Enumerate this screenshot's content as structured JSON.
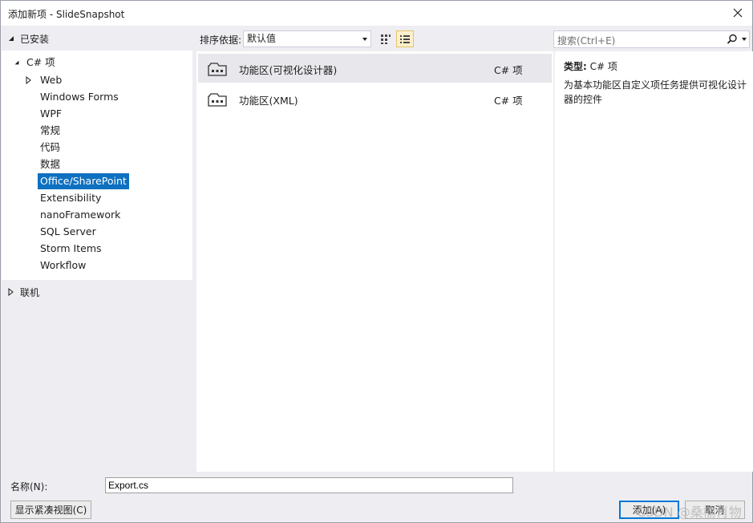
{
  "window": {
    "title": "添加新项 - SlideSnapshot"
  },
  "installed": {
    "label": "已安装"
  },
  "online": {
    "label": "联机"
  },
  "tree": {
    "root": "C# 项",
    "items": [
      {
        "label": "Web",
        "expandable": true
      },
      {
        "label": "Windows Forms"
      },
      {
        "label": "WPF"
      },
      {
        "label": "常规"
      },
      {
        "label": "代码"
      },
      {
        "label": "数据"
      },
      {
        "label": "Office/SharePoint",
        "selected": true
      },
      {
        "label": "Extensibility"
      },
      {
        "label": "nanoFramework"
      },
      {
        "label": "SQL Server"
      },
      {
        "label": "Storm Items"
      },
      {
        "label": "Workflow"
      }
    ]
  },
  "toolbar": {
    "sort_label": "排序依据:",
    "sort_value": "默认值",
    "search_placeholder": "搜索(Ctrl+E)"
  },
  "templates": [
    {
      "name": "功能区(可视化设计器)",
      "lang": "C# 项",
      "selected": true
    },
    {
      "name": "功能区(XML)",
      "lang": "C# 项"
    }
  ],
  "details": {
    "type_label": "类型:",
    "type_value": "C# 项",
    "description": "为基本功能区自定义项任务提供可视化设计器的控件"
  },
  "name_field": {
    "label": "名称(N):",
    "value": "Export.cs"
  },
  "buttons": {
    "compact": "显示紧凑视图(C)",
    "add": "添加(A)",
    "cancel": "取消"
  },
  "watermark": "CSDN @桑榆肖物",
  "colors": {
    "selection": "#0e70c0",
    "accent_border": "#0078d7"
  }
}
